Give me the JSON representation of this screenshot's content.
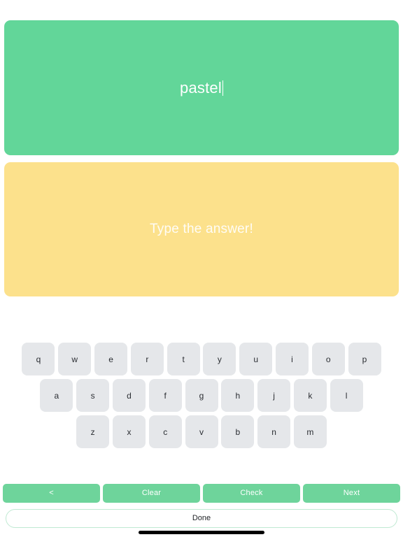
{
  "prompt_card": {
    "word": "pastel",
    "background_color": "#62D699",
    "text_color": "#FFFFFF"
  },
  "answer_card": {
    "placeholder": "Type the answer!",
    "value": "",
    "background_color": "#FCE18C",
    "text_color": "#FFFFFF"
  },
  "keyboard": {
    "key_background_color": "#E5E7EA",
    "key_text_color": "#2B2E33",
    "rows": [
      {
        "keys": [
          "q",
          "w",
          "e",
          "r",
          "t",
          "y",
          "u",
          "i",
          "o",
          "p"
        ]
      },
      {
        "keys": [
          "a",
          "s",
          "d",
          "f",
          "g",
          "h",
          "j",
          "k",
          "l"
        ]
      },
      {
        "keys": [
          "z",
          "x",
          "c",
          "v",
          "b",
          "n",
          "m"
        ]
      }
    ]
  },
  "actions": {
    "background_color": "#6ED49B",
    "buttons": [
      {
        "label": "<",
        "name": "back-button"
      },
      {
        "label": "Clear",
        "name": "clear-button"
      },
      {
        "label": "Check",
        "name": "check-button"
      },
      {
        "label": "Next",
        "name": "next-button"
      }
    ]
  },
  "done": {
    "label": "Done",
    "border_color": "#BFE9D2",
    "text_color": "#1F2226"
  }
}
